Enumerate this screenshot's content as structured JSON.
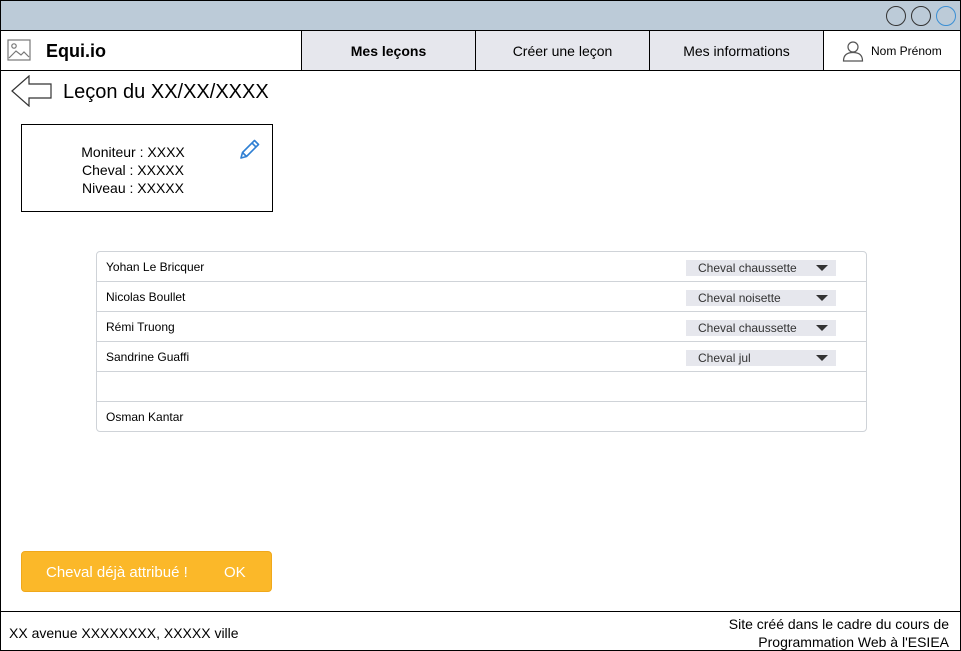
{
  "app": {
    "brand": "Equi.io"
  },
  "nav": {
    "tabs": [
      {
        "label": "Mes leçons"
      },
      {
        "label": "Créer une leçon"
      },
      {
        "label": "Mes informations"
      }
    ],
    "user": {
      "label": "Nom Prénom"
    }
  },
  "page": {
    "title": "Leçon du XX/XX/XXXX"
  },
  "info": {
    "moniteur": "Moniteur : XXXX",
    "cheval": "Cheval : XXXXX",
    "niveau": "Niveau : XXXXX"
  },
  "riders": [
    {
      "name": "Yohan Le Bricquer",
      "horse": "Cheval chaussette"
    },
    {
      "name": "Nicolas Boullet",
      "horse": "Cheval noisette"
    },
    {
      "name": "Rémi Truong",
      "horse": "Cheval chaussette"
    },
    {
      "name": "Sandrine Guaffi",
      "horse": "Cheval jul"
    },
    {
      "name": "",
      "horse": ""
    },
    {
      "name": "Osman Kantar",
      "horse": ""
    }
  ],
  "alert": {
    "message": "Cheval déjà attribué !",
    "ok": "OK",
    "color": "#fbb829"
  },
  "footer": {
    "address": "XX avenue XXXXXXXX, XXXXX ville",
    "credit_line1": "Site créé dans le cadre du cours de",
    "credit_line2": "Programmation Web à l'ESIEA"
  },
  "icons": {
    "logo": "image-icon",
    "user": "user-icon",
    "back": "back-arrow-icon",
    "edit": "pencil-icon",
    "caret": "chevron-down-icon"
  }
}
